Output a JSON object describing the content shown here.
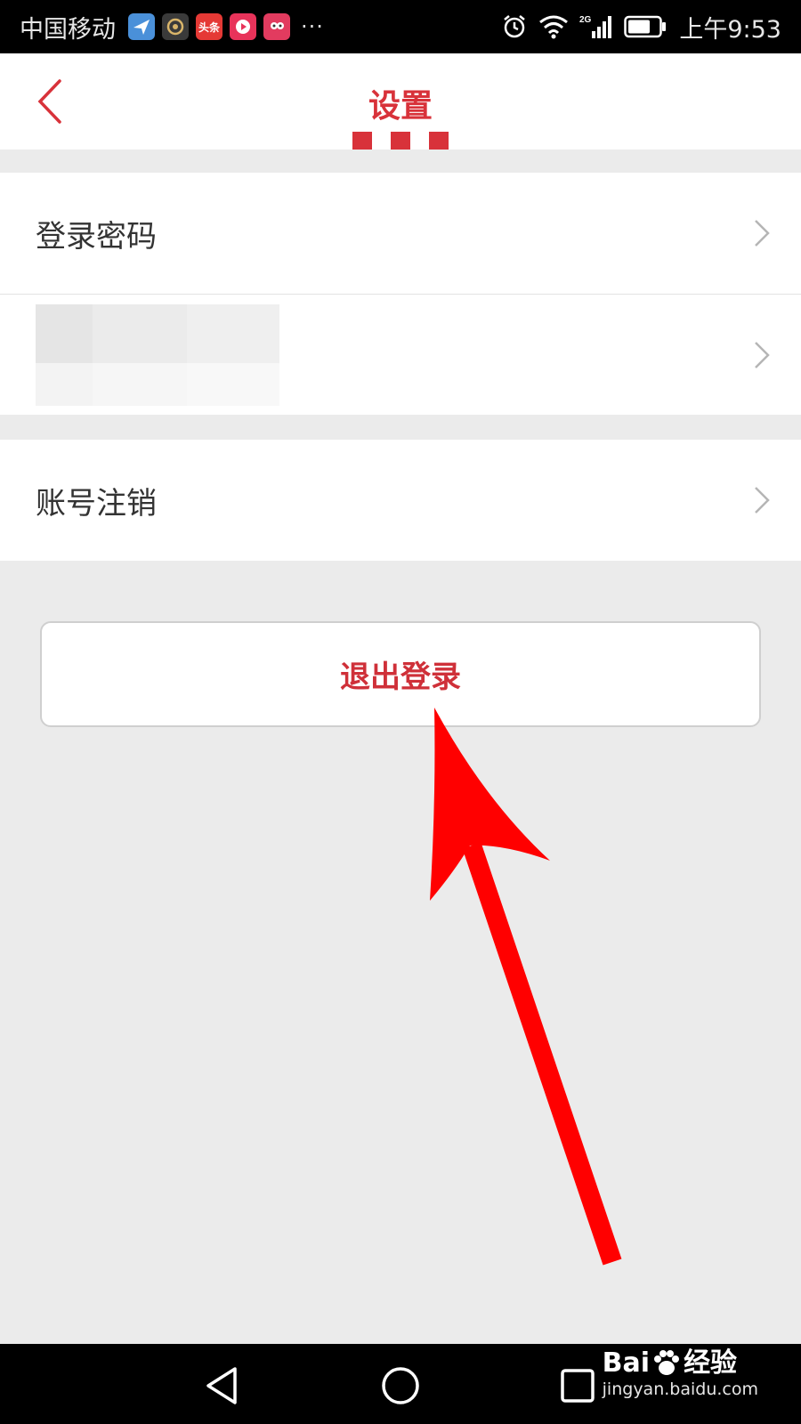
{
  "status_bar": {
    "carrier": "中国移动",
    "app_icons": [
      {
        "name": "maps-app-icon",
        "color": "#4a90d9",
        "label": ""
      },
      {
        "name": "camera-app-icon",
        "color": "#3a3a3a",
        "label": ""
      },
      {
        "name": "toutiao-app-icon",
        "color": "#e53935",
        "label": "头条"
      },
      {
        "name": "video-app-icon",
        "color": "#e8335a",
        "label": ""
      },
      {
        "name": "chat-app-icon",
        "color": "#e23b5f",
        "label": ""
      }
    ],
    "more": "···",
    "network": "2G",
    "time": "上午9:53"
  },
  "header": {
    "title": "设置",
    "accent_color": "#d8323a"
  },
  "settings": {
    "group1": [
      {
        "label": "登录密码"
      },
      {
        "label": ""
      }
    ],
    "group2": [
      {
        "label": "账号注销"
      }
    ]
  },
  "logout": {
    "label": "退出登录",
    "color": "#cf3039"
  },
  "watermark": {
    "brand_a": "Bai",
    "brand_b": "经验",
    "url": "jingyan.baidu.com"
  }
}
